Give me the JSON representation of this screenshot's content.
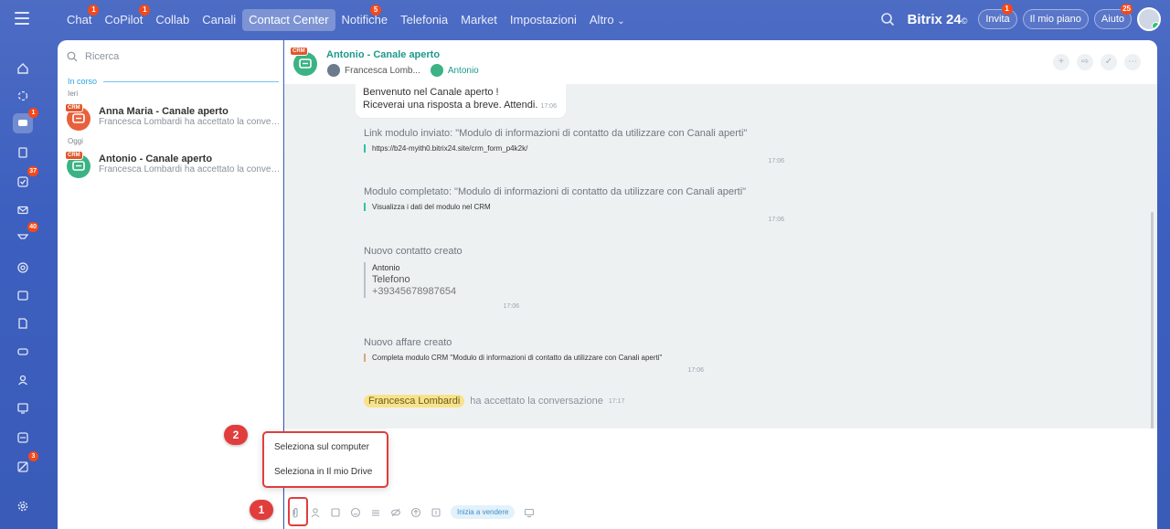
{
  "topnav": {
    "items": [
      {
        "label": "Chat",
        "badge": "1"
      },
      {
        "label": "CoPilot",
        "badge": "1"
      },
      {
        "label": "Collab",
        "badge": ""
      },
      {
        "label": "Canali",
        "badge": ""
      },
      {
        "label": "Contact Center",
        "badge": "",
        "active": true
      },
      {
        "label": "Notifiche",
        "badge": "5"
      },
      {
        "label": "Telefonia",
        "badge": ""
      },
      {
        "label": "Market",
        "badge": ""
      },
      {
        "label": "Impostazioni",
        "badge": ""
      },
      {
        "label": "Altro",
        "badge": ""
      }
    ],
    "altro_arrow": "⌄",
    "brand": "Bitrix",
    "brand_num": "24",
    "brand_suffix": "©",
    "invita": "Invita",
    "invita_badge": "1",
    "piano": "Il mio piano",
    "aiuto": "Aiuto",
    "aiuto_badge": "25"
  },
  "rail": {
    "chat_badge": "1",
    "tasks_badge": "37",
    "feed_badge": "40",
    "misc_badge": "3"
  },
  "list": {
    "search_placeholder": "Ricerca",
    "section": "In corso",
    "day1": "Ieri",
    "day2": "Oggi",
    "crm_tag": "CRM",
    "chats": [
      {
        "name": "Anna Maria - Canale aperto",
        "preview": "Francesca Lombardi ha accettato la convers..."
      },
      {
        "name": "Antonio - Canale aperto",
        "preview": "Francesca Lombardi ha accettato la convers..."
      }
    ]
  },
  "header": {
    "title": "Antonio - Canale aperto",
    "member1": "Francesca Lomb...",
    "member2": "Antonio"
  },
  "messages": {
    "welcome_line1": "Benvenuto nel Canale aperto !",
    "welcome_line2": "Riceverai una risposta a breve. Attendi.",
    "welcome_time": "17:06",
    "m1_title": "Link modulo inviato: \"Modulo di informazioni di contatto da utilizzare con Canali aperti\"",
    "m1_body": "https://b24-myith0.bitrix24.site/crm_form_p4k2k/",
    "m1_time": "17:06",
    "m2_title": "Modulo completato: \"Modulo di informazioni di contatto da utilizzare con Canali aperti\"",
    "m2_body": "Visualizza i dati del modulo nel CRM",
    "m2_time": "17:06",
    "m3_title": "Nuovo contatto creato",
    "m3_name": "Antonio",
    "m3_field": "Telefono",
    "m3_phone": "+39345678987654",
    "m3_time": "17:06",
    "m4_title": "Nuovo affare creato",
    "m4_body": "Completa modulo CRM \"Modulo di informazioni di contatto da utilizzare con Canali aperti\"",
    "m4_time": "17:06",
    "accepted_name": "Francesca Lombardi",
    "accepted_text": "ha accettato la conversazione",
    "accepted_time": "17:17"
  },
  "popup": {
    "item1": "Seleziona sul computer",
    "item2": "Seleziona in Il mio Drive"
  },
  "toolbar": {
    "sell_label": "Inizia a vendere"
  },
  "annotations": {
    "marker1": "1",
    "marker2": "2"
  }
}
